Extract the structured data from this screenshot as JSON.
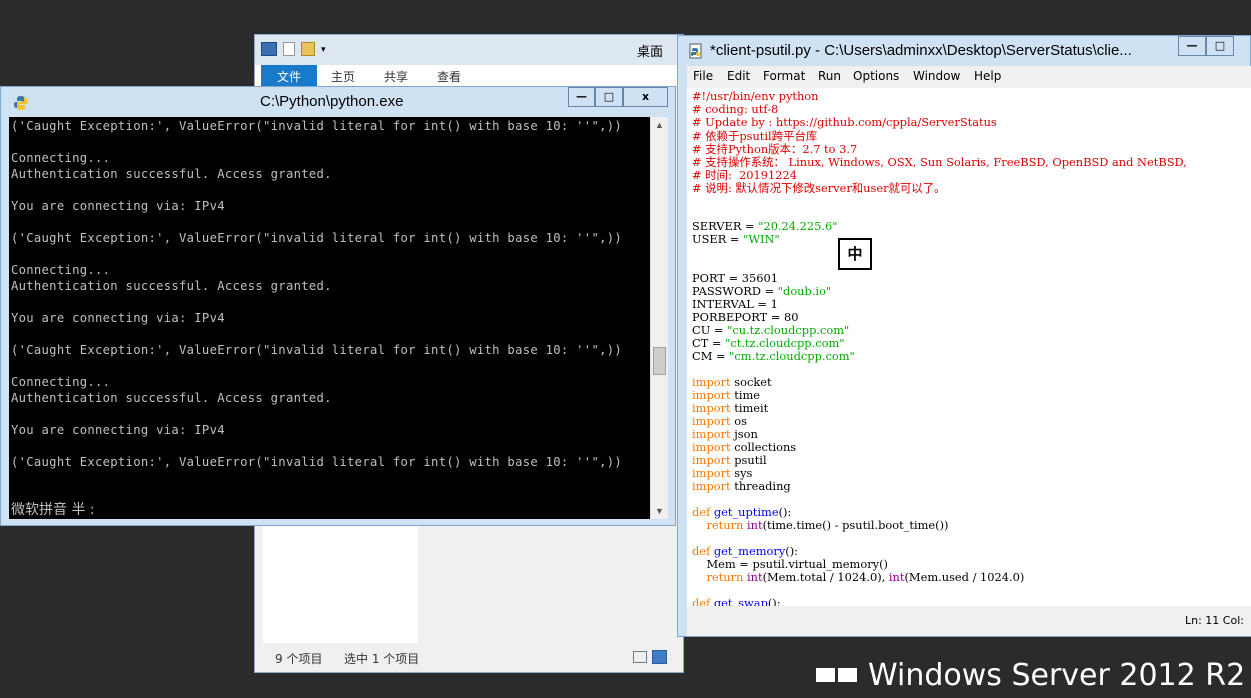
{
  "watermark": {
    "text": "Windows Server 2012 R2"
  },
  "explorer": {
    "title": "桌面",
    "tabs": [
      "文件",
      "主页",
      "共享",
      "查看"
    ],
    "status_items": "9 个项目",
    "status_selected": "选中 1 个项目"
  },
  "console": {
    "title": "C:\\Python\\python.exe",
    "controls": {
      "minimize": "—",
      "maximize": "□",
      "close": "x"
    },
    "lines": [
      "('Caught Exception:', ValueError(\"invalid literal for int() with base 10: ''\",))",
      "",
      "Connecting...",
      "Authentication successful. Access granted.",
      "",
      "You are connecting via: IPv4",
      "",
      "('Caught Exception:', ValueError(\"invalid literal for int() with base 10: ''\",))",
      "",
      "Connecting...",
      "Authentication successful. Access granted.",
      "",
      "You are connecting via: IPv4",
      "",
      "('Caught Exception:', ValueError(\"invalid literal for int() with base 10: ''\",))",
      "",
      "Connecting...",
      "Authentication successful. Access granted.",
      "",
      "You are connecting via: IPv4",
      "",
      "('Caught Exception:', ValueError(\"invalid literal for int() with base 10: ''\",))"
    ],
    "ime_status": "微软拼音 半 :"
  },
  "idle": {
    "title": "*client-psutil.py - C:\\Users\\adminxx\\Desktop\\ServerStatus\\clie...",
    "controls": {
      "minimize": "—",
      "maximize": "□"
    },
    "menu": [
      "File",
      "Edit",
      "Format",
      "Run",
      "Options",
      "Window",
      "Help"
    ],
    "status": "Ln: 11   Col:",
    "ime_indicator": "中",
    "code_lines": [
      [
        [
          "c-red",
          "#!/usr/bin/env python"
        ]
      ],
      [
        [
          "c-red",
          "# coding: utf-8"
        ]
      ],
      [
        [
          "c-red",
          "# Update by : https://github.com/cppla/ServerStatus"
        ]
      ],
      [
        [
          "c-red",
          "# 依赖于psutil跨平台库"
        ]
      ],
      [
        [
          "c-red",
          "# 支持Python版本：2.7 to 3.7"
        ]
      ],
      [
        [
          "c-red",
          "# 支持操作系统： Linux, Windows, OSX, Sun Solaris, FreeBSD, OpenBSD and NetBSD,"
        ]
      ],
      [
        [
          "c-red",
          "# 时间:  20191224"
        ]
      ],
      [
        [
          "c-red",
          "# 说明: 默认情况下修改server和user就可以了。"
        ]
      ],
      [],
      [],
      [
        [
          "",
          "SERVER = "
        ],
        [
          "c-green",
          "\"20.24.225.6\""
        ]
      ],
      [
        [
          "",
          "USER = "
        ],
        [
          "c-green",
          "\"WIN\""
        ]
      ],
      [],
      [],
      [
        [
          "",
          "PORT = 35601"
        ]
      ],
      [
        [
          "",
          "PASSWORD = "
        ],
        [
          "c-green",
          "\"doub.io\""
        ]
      ],
      [
        [
          "",
          "INTERVAL = 1"
        ]
      ],
      [
        [
          "",
          "PORBEPORT = 80"
        ]
      ],
      [
        [
          "",
          "CU = "
        ],
        [
          "c-green",
          "\"cu.tz.cloudcpp.com\""
        ]
      ],
      [
        [
          "",
          "CT = "
        ],
        [
          "c-green",
          "\"ct.tz.cloudcpp.com\""
        ]
      ],
      [
        [
          "",
          "CM = "
        ],
        [
          "c-green",
          "\"cm.tz.cloudcpp.com\""
        ]
      ],
      [],
      [
        [
          "c-orange",
          "import"
        ],
        [
          "",
          " socket"
        ]
      ],
      [
        [
          "c-orange",
          "import"
        ],
        [
          "",
          " time"
        ]
      ],
      [
        [
          "c-orange",
          "import"
        ],
        [
          "",
          " timeit"
        ]
      ],
      [
        [
          "c-orange",
          "import"
        ],
        [
          "",
          " os"
        ]
      ],
      [
        [
          "c-orange",
          "import"
        ],
        [
          "",
          " json"
        ]
      ],
      [
        [
          "c-orange",
          "import"
        ],
        [
          "",
          " collections"
        ]
      ],
      [
        [
          "c-orange",
          "import"
        ],
        [
          "",
          " psutil"
        ]
      ],
      [
        [
          "c-orange",
          "import"
        ],
        [
          "",
          " sys"
        ]
      ],
      [
        [
          "c-orange",
          "import"
        ],
        [
          "",
          " threading"
        ]
      ],
      [],
      [
        [
          "c-orange",
          "def"
        ],
        [
          "",
          " "
        ],
        [
          "c-blue",
          "get_uptime"
        ],
        [
          "",
          "():"
        ]
      ],
      [
        [
          "",
          "    "
        ],
        [
          "c-orange",
          "return"
        ],
        [
          "",
          " "
        ],
        [
          "c-purple",
          "int"
        ],
        [
          "",
          "(time.time() - psutil.boot_time())"
        ]
      ],
      [],
      [
        [
          "c-orange",
          "def"
        ],
        [
          "",
          " "
        ],
        [
          "c-blue",
          "get_memory"
        ],
        [
          "",
          "():"
        ]
      ],
      [
        [
          "",
          "    Mem = psutil.virtual_memory()"
        ]
      ],
      [
        [
          "",
          "    "
        ],
        [
          "c-orange",
          "return"
        ],
        [
          "",
          " "
        ],
        [
          "c-purple",
          "int"
        ],
        [
          "",
          "(Mem.total / 1024.0), "
        ],
        [
          "c-purple",
          "int"
        ],
        [
          "",
          "(Mem.used / 1024.0)"
        ]
      ],
      [],
      [
        [
          "c-orange",
          "def"
        ],
        [
          "",
          " "
        ],
        [
          "c-blue",
          "get_swap"
        ],
        [
          "",
          "():"
        ]
      ]
    ]
  }
}
